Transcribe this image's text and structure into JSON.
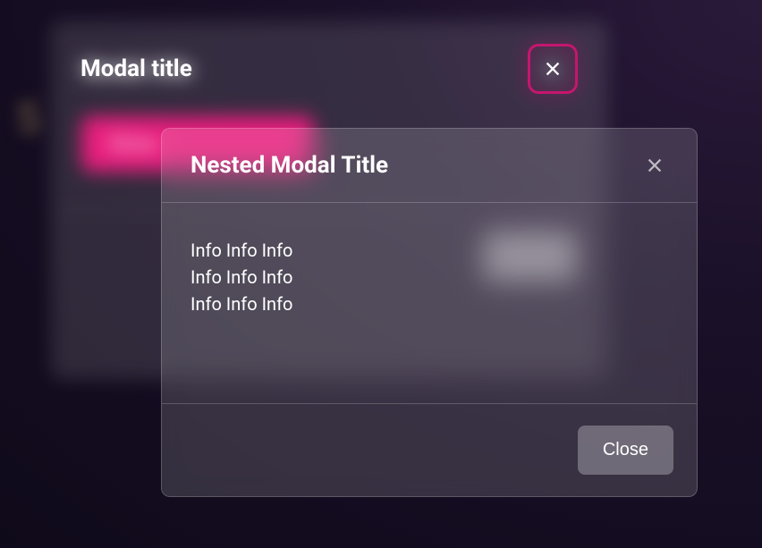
{
  "page": {
    "section_number": "5"
  },
  "first_modal": {
    "title": "Modal title",
    "show_button_label": "Show",
    "close_label": "Close"
  },
  "nested_modal": {
    "title": "Nested Modal Title",
    "body_lines": [
      "Info Info Info",
      "Info Info Info",
      "Info Info Info"
    ],
    "close_label": "Close"
  }
}
